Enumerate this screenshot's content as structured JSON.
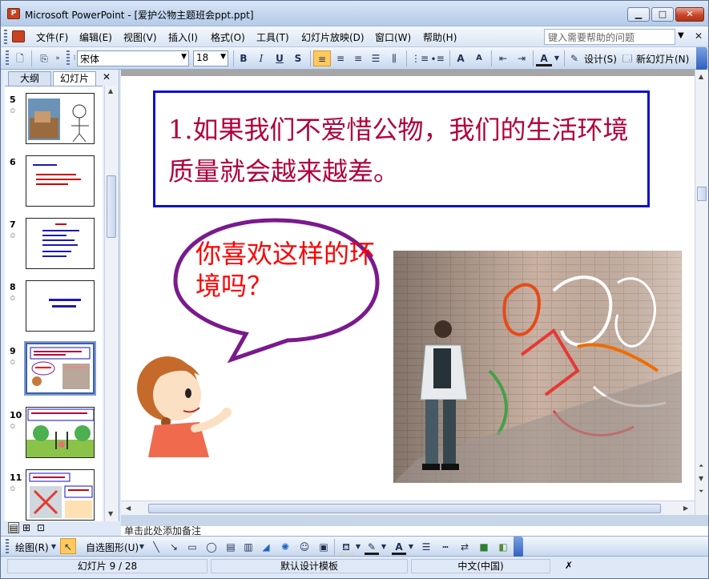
{
  "window": {
    "title": "Microsoft PowerPoint - [爱护公物主题班会ppt.ppt]",
    "app_icon_glyph": "P",
    "minimize_glyph": "▁",
    "maximize_glyph": "□",
    "close_glyph": "✕"
  },
  "menu": {
    "items": [
      "文件(F)",
      "编辑(E)",
      "视图(V)",
      "插入(I)",
      "格式(O)",
      "工具(T)",
      "幻灯片放映(D)",
      "窗口(W)",
      "帮助(H)"
    ],
    "help_placeholder": "键入需要帮助的问题",
    "close_glyph": "✕"
  },
  "toolbar": {
    "font_name": "宋体",
    "font_size": "18",
    "bold": "B",
    "italic": "I",
    "underline": "U",
    "shadow": "S",
    "design_label": "设计(S)",
    "new_slide_label": "新幻灯片(N)",
    "font_color_glyph": "A",
    "grow_glyph": "A",
    "shrink_glyph": "A"
  },
  "left_panel": {
    "tab_outline": "大纲",
    "tab_slides": "幻灯片",
    "close_glyph": "✕",
    "slides": [
      {
        "num": "5"
      },
      {
        "num": "6"
      },
      {
        "num": "7"
      },
      {
        "num": "8"
      },
      {
        "num": "9"
      },
      {
        "num": "10"
      },
      {
        "num": "11"
      }
    ],
    "selected_slide": "9"
  },
  "slide": {
    "title": "1.如果我们不爱惜公物，我们的生活环境质量就会越来越差。",
    "bubble_text": "你喜欢这样的环境吗？"
  },
  "notes": {
    "placeholder": "单击此处添加备注"
  },
  "drawing_toolbar": {
    "draw_label": "绘图(R)",
    "autoshapes_label": "自选图形(U)"
  },
  "status": {
    "slide_position": "幻灯片 9 / 28",
    "template": "默认设计模板",
    "language": "中文(中国)"
  },
  "colors": {
    "title_text": "#b0003d",
    "title_border": "#0f11c9",
    "bubble_text": "#ff0000",
    "bubble_outline": "#7a1a8c"
  }
}
